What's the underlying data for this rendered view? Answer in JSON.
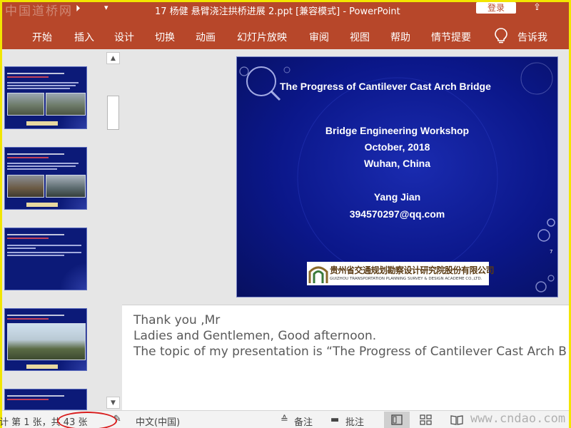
{
  "titlebar": {
    "watermark_logo": "中国道桥网",
    "document_title": "17 杨健 悬臂浇注拱桥进展 2.ppt [兼容模式]  -  PowerPoint",
    "login_label": "登录"
  },
  "ribbon": {
    "tabs": [
      "开始",
      "插入",
      "设计",
      "切换",
      "动画",
      "幻灯片放映",
      "审阅",
      "视图",
      "帮助",
      "情节提要",
      "告诉我"
    ]
  },
  "slide": {
    "title": "The Progress of Cantilever Cast Arch Bridge",
    "line1": "Bridge Engineering Workshop",
    "line2": "October, 2018",
    "line3": "Wuhan, China",
    "author": "Yang Jian",
    "email": "394570297@qq.com",
    "logo_cn": "贵州省交通规划勘察设计研究院股份有限公司",
    "logo_en": "GUIZHOU TRANSPORTATION PLANNING SURVEY & DESIGN ACADEME CO.,LTD."
  },
  "notes": {
    "line1": "Thank you ,Mr",
    "line2": "Ladies and Gentlemen, Good afternoon.",
    "line3": "The topic of my presentation is “The Progress of Cantilever Cast Arch B"
  },
  "statusbar": {
    "slide_counter": "计 第 1 张，共 43 张",
    "language": "中文(中国)",
    "notes_label": "备注",
    "comments_label": "批注",
    "watermark": "www.cndao.com"
  },
  "colors": {
    "accent": "#b7472a",
    "slide_background": "#0b178a",
    "highlight_circle": "#d81c1c"
  }
}
